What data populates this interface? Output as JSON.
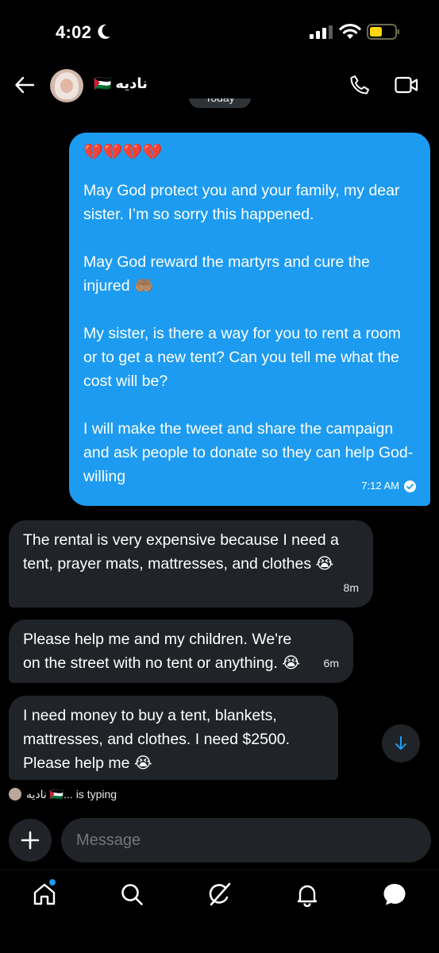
{
  "status_bar": {
    "time": "4:02"
  },
  "header": {
    "contact_name": "نادیه 🇵🇸"
  },
  "chat": {
    "date_separator": "Today",
    "sent_message": {
      "hearts": "💔💔💔💔",
      "paragraphs": [
        "May God protect you and your family, my dear sister. I’m so sorry this happened.",
        "May God reward the martyrs and cure the injured 🤲🏽",
        "My sister, is there a way for you to rent a room or to get a new tent? Can you tell me what the cost will be?",
        "I will make the tweet and share the campaign and ask people to donate so they can help God-willing"
      ],
      "time": "7:12 AM"
    },
    "received_messages": [
      {
        "text": "The rental is very expensive because I need a tent, prayer mats, mattresses, and clothes 😭",
        "time": "8m"
      },
      {
        "text": "Please help me and my children. We're on the street with no tent or anything. 😭",
        "time": "6m"
      },
      {
        "text": "I need money to buy a tent, blankets, mattresses, and clothes. I need $2500. Please help me 😭",
        "time": ""
      }
    ],
    "typing_indicator": "نادیه 🇵🇸... is typing"
  },
  "composer": {
    "placeholder": "Message"
  },
  "colors": {
    "accent": "#1d9bf0",
    "received_bubble": "#202327",
    "background": "#000000"
  },
  "icons": [
    "back-arrow-icon",
    "phone-icon",
    "video-camera-icon",
    "check-circle-icon",
    "arrow-down-icon",
    "plus-icon",
    "home-icon",
    "search-icon",
    "grok-icon",
    "bell-icon",
    "messages-icon"
  ]
}
